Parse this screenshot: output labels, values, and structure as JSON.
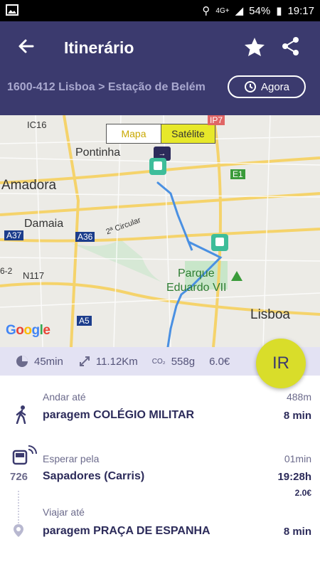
{
  "status": {
    "time": "19:17",
    "battery": "54%",
    "network": "4G+"
  },
  "header": {
    "title": "Itinerário",
    "route": "1600-412 Lisboa > Estação de Belém",
    "when_label": "Agora"
  },
  "map": {
    "toggle": {
      "map": "Mapa",
      "satellite": "Satélite"
    },
    "labels": {
      "ic16": "IC16",
      "ip7": "IP7",
      "pontinha": "Pontinha",
      "amadora": "Amadora",
      "e1": "E1",
      "damaia": "Damaia",
      "a37": "A37",
      "a36": "A36",
      "circular": "2ª Circular",
      "n117": "N117",
      "ic2": "6-2",
      "parque": "Parque",
      "eduardo": "Eduardo VII",
      "lisboa": "Lisboa",
      "a5": "A5"
    },
    "google": "Google"
  },
  "summary": {
    "duration": "45min",
    "distance": "11.12Km",
    "co2_label": "CO₂",
    "co2": "558g",
    "price": "6.0€"
  },
  "go_button": "IR",
  "steps": [
    {
      "hint": "Andar até",
      "place": "paragem COLÉGIO MILITAR",
      "distance": "488m",
      "time": "8 min",
      "icon": "walk-icon"
    },
    {
      "hint": "Esperar pela",
      "line": "726",
      "place": "Sapadores (Carris)",
      "wait": "01min",
      "clock": "19:28h",
      "price": "2.0€",
      "icon": "bus-icon"
    },
    {
      "hint": "Viajar até",
      "place": "paragem PRAÇA DE ESPANHA",
      "time": "8 min",
      "icon": "pin-icon"
    }
  ]
}
